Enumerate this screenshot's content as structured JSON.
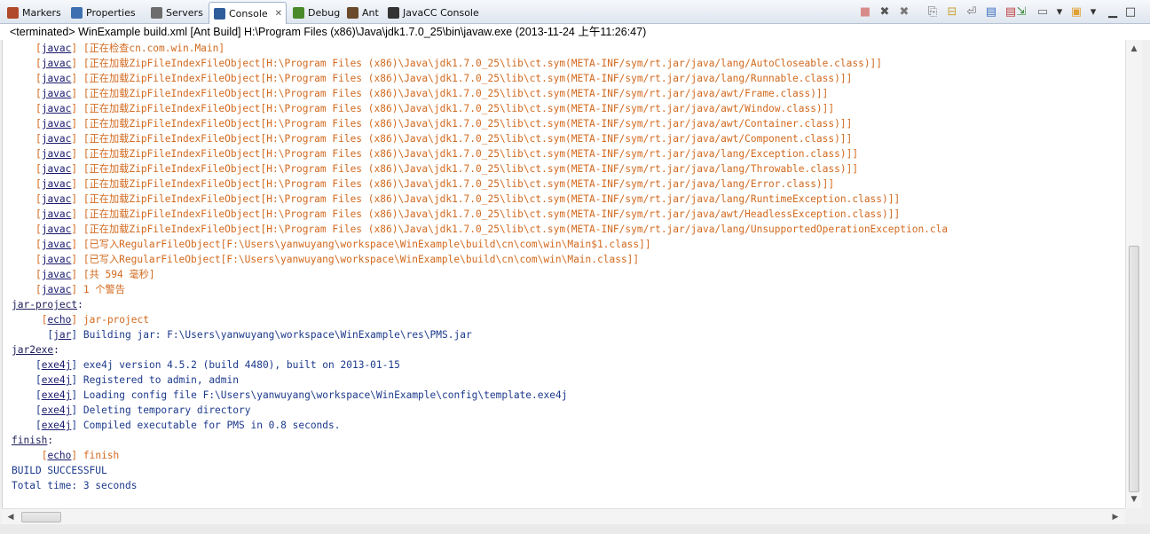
{
  "tabs": [
    {
      "label": "Markers",
      "icon": "markers-icon",
      "color": "#b04a2a"
    },
    {
      "label": "Properties",
      "icon": "properties-icon",
      "color": "#3e6fb0"
    },
    {
      "label": "Servers",
      "icon": "servers-icon",
      "color": "#6d6d6d"
    },
    {
      "label": "Console",
      "icon": "console-icon",
      "color": "#2f5d9a",
      "active": true
    },
    {
      "label": "Debug",
      "icon": "debug-icon",
      "color": "#4a8a2a"
    },
    {
      "label": "Ant",
      "icon": "ant-icon",
      "color": "#6a4a2a"
    },
    {
      "label": "JavaCC Console",
      "icon": "javacc-console-icon",
      "color": "#333333"
    }
  ],
  "toolbar": {
    "buttons": [
      {
        "name": "terminate-icon",
        "glyph": "■",
        "color": "#d88a8a"
      },
      {
        "name": "remove-launch-icon",
        "glyph": "✖",
        "color": "#555555"
      },
      {
        "name": "remove-all-terminated-icon",
        "glyph": "✖",
        "color": "#777777"
      },
      {
        "name": "clear-console-icon",
        "glyph": "⎘",
        "color": "#666666"
      },
      {
        "name": "scroll-lock-icon",
        "glyph": "⊟",
        "color": "#c9a030"
      },
      {
        "name": "word-wrap-icon",
        "glyph": "⏎",
        "color": "#6a6a6a"
      },
      {
        "name": "show-on-stdout-icon",
        "glyph": "▤",
        "color": "#3c70c0"
      },
      {
        "name": "show-on-stderr-icon",
        "glyph": "▤",
        "color": "#c04040"
      },
      {
        "name": "pin-console-icon",
        "glyph": "⇲",
        "color": "#3c8a3c"
      },
      {
        "name": "display-selected-console-icon",
        "glyph": "▭",
        "color": "#666666"
      },
      {
        "name": "display-selected-dropdown-icon",
        "glyph": "▾",
        "color": "#333333"
      },
      {
        "name": "open-console-icon",
        "glyph": "▣",
        "color": "#e0a030"
      },
      {
        "name": "open-console-dropdown-icon",
        "glyph": "▾",
        "color": "#333333"
      },
      {
        "name": "minimize-icon",
        "glyph": "▁",
        "color": "#333333"
      },
      {
        "name": "maximize-icon",
        "glyph": "□",
        "color": "#333333"
      }
    ]
  },
  "launch_info": "<terminated> WinExample build.xml [Ant Build] H:\\Program Files (x86)\\Java\\jdk1.7.0_25\\bin\\javaw.exe (2013-11-24 上午11:26:47)",
  "colors": {
    "output_orange": "#d2691e",
    "output_blue": "#1c3a8c"
  },
  "console_lines": [
    {
      "indent": "    ",
      "tag": "javac",
      "text": "[正在检查cn.com.win.Main]",
      "color": "o"
    },
    {
      "indent": "    ",
      "tag": "javac",
      "text": "[正在加载ZipFileIndexFileObject[H:\\Program Files (x86)\\Java\\jdk1.7.0_25\\lib\\ct.sym(META-INF/sym/rt.jar/java/lang/AutoCloseable.class)]]",
      "color": "o"
    },
    {
      "indent": "    ",
      "tag": "javac",
      "text": "[正在加载ZipFileIndexFileObject[H:\\Program Files (x86)\\Java\\jdk1.7.0_25\\lib\\ct.sym(META-INF/sym/rt.jar/java/lang/Runnable.class)]]",
      "color": "o"
    },
    {
      "indent": "    ",
      "tag": "javac",
      "text": "[正在加载ZipFileIndexFileObject[H:\\Program Files (x86)\\Java\\jdk1.7.0_25\\lib\\ct.sym(META-INF/sym/rt.jar/java/awt/Frame.class)]]",
      "color": "o"
    },
    {
      "indent": "    ",
      "tag": "javac",
      "text": "[正在加载ZipFileIndexFileObject[H:\\Program Files (x86)\\Java\\jdk1.7.0_25\\lib\\ct.sym(META-INF/sym/rt.jar/java/awt/Window.class)]]",
      "color": "o"
    },
    {
      "indent": "    ",
      "tag": "javac",
      "text": "[正在加载ZipFileIndexFileObject[H:\\Program Files (x86)\\Java\\jdk1.7.0_25\\lib\\ct.sym(META-INF/sym/rt.jar/java/awt/Container.class)]]",
      "color": "o"
    },
    {
      "indent": "    ",
      "tag": "javac",
      "text": "[正在加载ZipFileIndexFileObject[H:\\Program Files (x86)\\Java\\jdk1.7.0_25\\lib\\ct.sym(META-INF/sym/rt.jar/java/awt/Component.class)]]",
      "color": "o"
    },
    {
      "indent": "    ",
      "tag": "javac",
      "text": "[正在加载ZipFileIndexFileObject[H:\\Program Files (x86)\\Java\\jdk1.7.0_25\\lib\\ct.sym(META-INF/sym/rt.jar/java/lang/Exception.class)]]",
      "color": "o"
    },
    {
      "indent": "    ",
      "tag": "javac",
      "text": "[正在加载ZipFileIndexFileObject[H:\\Program Files (x86)\\Java\\jdk1.7.0_25\\lib\\ct.sym(META-INF/sym/rt.jar/java/lang/Throwable.class)]]",
      "color": "o"
    },
    {
      "indent": "    ",
      "tag": "javac",
      "text": "[正在加载ZipFileIndexFileObject[H:\\Program Files (x86)\\Java\\jdk1.7.0_25\\lib\\ct.sym(META-INF/sym/rt.jar/java/lang/Error.class)]]",
      "color": "o"
    },
    {
      "indent": "    ",
      "tag": "javac",
      "text": "[正在加载ZipFileIndexFileObject[H:\\Program Files (x86)\\Java\\jdk1.7.0_25\\lib\\ct.sym(META-INF/sym/rt.jar/java/lang/RuntimeException.class)]]",
      "color": "o"
    },
    {
      "indent": "    ",
      "tag": "javac",
      "text": "[正在加载ZipFileIndexFileObject[H:\\Program Files (x86)\\Java\\jdk1.7.0_25\\lib\\ct.sym(META-INF/sym/rt.jar/java/awt/HeadlessException.class)]]",
      "color": "o"
    },
    {
      "indent": "    ",
      "tag": "javac",
      "text": "[正在加载ZipFileIndexFileObject[H:\\Program Files (x86)\\Java\\jdk1.7.0_25\\lib\\ct.sym(META-INF/sym/rt.jar/java/lang/UnsupportedOperationException.cla",
      "color": "o"
    },
    {
      "indent": "    ",
      "tag": "javac",
      "text": "[已写入RegularFileObject[F:\\Users\\yanwuyang\\workspace\\WinExample\\build\\cn\\com\\win\\Main$1.class]]",
      "color": "o"
    },
    {
      "indent": "    ",
      "tag": "javac",
      "text": "[已写入RegularFileObject[F:\\Users\\yanwuyang\\workspace\\WinExample\\build\\cn\\com\\win\\Main.class]]",
      "color": "o"
    },
    {
      "indent": "    ",
      "tag": "javac",
      "text": "[共 594 毫秒]",
      "color": "o"
    },
    {
      "indent": "    ",
      "tag": "javac",
      "text": "1 个警告",
      "color": "o"
    },
    {
      "target": "jar-project"
    },
    {
      "indent": "     ",
      "tag": "echo",
      "text": "jar-project",
      "color": "o"
    },
    {
      "indent": "      ",
      "tag": "jar",
      "text": "Building jar: F:\\Users\\yanwuyang\\workspace\\WinExample\\res\\PMS.jar",
      "color": "b"
    },
    {
      "target": "jar2exe"
    },
    {
      "indent": "    ",
      "tag": "exe4j",
      "text": "exe4j version 4.5.2 (build 4480), built on 2013-01-15",
      "color": "b"
    },
    {
      "indent": "    ",
      "tag": "exe4j",
      "text": "Registered to admin, admin",
      "color": "b"
    },
    {
      "indent": "    ",
      "tag": "exe4j",
      "text": "Loading config file F:\\Users\\yanwuyang\\workspace\\WinExample\\config\\template.exe4j",
      "color": "b"
    },
    {
      "indent": "    ",
      "tag": "exe4j",
      "text": "Deleting temporary directory",
      "color": "b"
    },
    {
      "indent": "    ",
      "tag": "exe4j",
      "text": "Compiled executable for PMS in 0.8 seconds.",
      "color": "b"
    },
    {
      "target": "finish"
    },
    {
      "indent": "     ",
      "tag": "echo",
      "text": "finish",
      "color": "o"
    },
    {
      "plain": "BUILD SUCCESSFUL",
      "color": "b"
    },
    {
      "plain": "Total time: 3 seconds",
      "color": "b"
    }
  ]
}
